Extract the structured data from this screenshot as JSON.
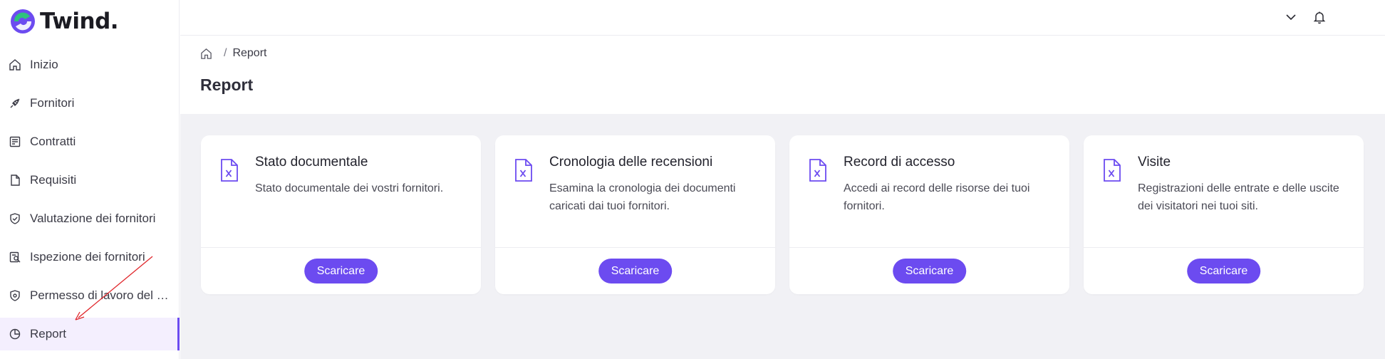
{
  "app": {
    "logo_text": "Twind.",
    "accent_color": "#6c4bf0"
  },
  "sidebar": {
    "items": [
      {
        "label": "Inizio",
        "icon": "home-icon"
      },
      {
        "label": "Fornitori",
        "icon": "plug-icon"
      },
      {
        "label": "Contratti",
        "icon": "contract-icon"
      },
      {
        "label": "Requisiti",
        "icon": "document-icon"
      },
      {
        "label": "Valutazione dei fornitori",
        "icon": "shield-check-icon"
      },
      {
        "label": "Ispezione dei fornitori",
        "icon": "inspection-icon"
      },
      {
        "label": "Permesso di lavoro del f...",
        "icon": "shield-badge-icon"
      },
      {
        "label": "Report",
        "icon": "pie-chart-icon",
        "active": true
      }
    ]
  },
  "topbar": {
    "icons": [
      "chevron-down-icon",
      "bell-icon"
    ]
  },
  "breadcrumb": {
    "separator": "/",
    "current": "Report"
  },
  "page": {
    "title": "Report"
  },
  "cards": [
    {
      "title": "Stato documentale",
      "description": "Stato documentale dei vostri fornitori.",
      "button": "Scaricare"
    },
    {
      "title": "Cronologia delle recensioni",
      "description": "Esamina la cronologia dei documenti caricati dai tuoi fornitori.",
      "button": "Scaricare"
    },
    {
      "title": "Record di accesso",
      "description": "Accedi ai record delle risorse dei tuoi fornitori.",
      "button": "Scaricare"
    },
    {
      "title": "Visite",
      "description": "Registrazioni delle entrate e delle uscite dei visitatori nei tuoi siti.",
      "button": "Scaricare"
    }
  ],
  "annotations": {
    "highlight_color": "#fff100",
    "arrow_color": "#e0262b"
  }
}
